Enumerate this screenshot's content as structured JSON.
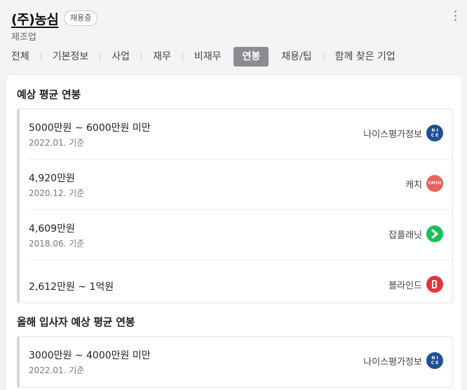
{
  "company": {
    "name": "(주)농심",
    "badge": "채용중",
    "industry": "제조업"
  },
  "tabs": [
    {
      "label": "전체",
      "active": false
    },
    {
      "label": "기본정보",
      "active": false
    },
    {
      "label": "사업",
      "active": false
    },
    {
      "label": "재무",
      "active": false
    },
    {
      "label": "비재무",
      "active": false
    },
    {
      "label": "연봉",
      "active": true
    },
    {
      "label": "채용/팁",
      "active": false
    },
    {
      "label": "함께 찾은 기업",
      "active": false
    }
  ],
  "expected_salary": {
    "title": "예상 평균 연봉",
    "rows": [
      {
        "amount": "5000만원 ~ 6000만원 미만",
        "date": "2022.01. 기준",
        "source": "나이스평가정보",
        "logo": "nice-logo-icon"
      },
      {
        "amount": "4,920만원",
        "date": "2020.12. 기준",
        "source": "캐치",
        "logo": "catch-logo-icon"
      },
      {
        "amount": "4,609만원",
        "date": "2018.06. 기준",
        "source": "잡플래닛",
        "logo": "jobplanet-logo-icon"
      },
      {
        "amount": "2,612만원 ~ 1억원",
        "date": "",
        "source": "블라인드",
        "logo": "blind-logo-icon"
      }
    ]
  },
  "new_hire_salary": {
    "title": "올해 입사자 예상 평균 연봉",
    "rows": [
      {
        "amount": "3000만원 ~ 4000만원 미만",
        "date": "2022.01. 기준",
        "source": "나이스평가정보",
        "logo": "nice-logo-icon"
      }
    ]
  },
  "logo_text": {
    "nice": "N I\nC E",
    "catch": "CATCH"
  },
  "colors": {
    "active_tab": "#8a8c91",
    "nice": "#1f4f97",
    "catch": "#e3655b",
    "jobplanet": "#19c15d",
    "blind": "#e0363d"
  }
}
